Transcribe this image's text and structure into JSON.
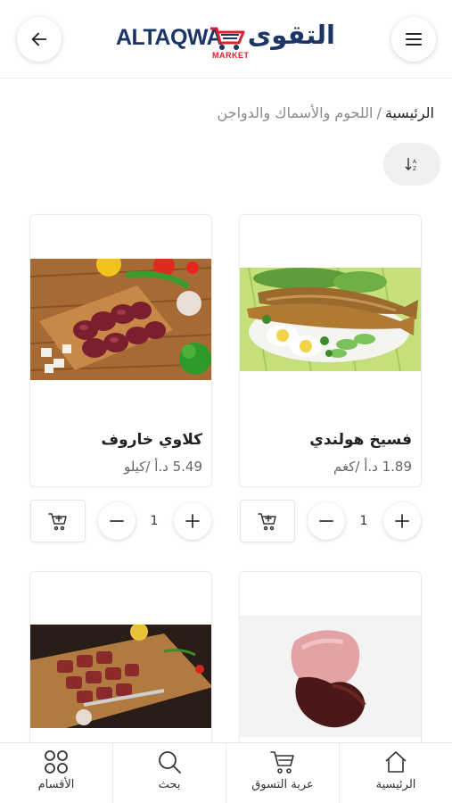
{
  "header": {
    "logo_latin": "ALTAQWA",
    "logo_arabic": "التقوى",
    "logo_market": "MARKET"
  },
  "breadcrumb": {
    "home": "الرئيسية",
    "separator": "/",
    "current": "اللحوم والأسماك والدواجن"
  },
  "products": [
    {
      "name": "فسيخ هولندي",
      "price": "1.89 د.أ /كغم",
      "quantity": "1",
      "image": "smoked-fish"
    },
    {
      "name": "كلاوي خاروف",
      "price": "5.49 د.أ /كيلو",
      "quantity": "1",
      "image": "lamb-kidneys"
    },
    {
      "name": "",
      "price": "",
      "quantity": "",
      "image": "liver"
    },
    {
      "name": "",
      "price": "",
      "quantity": "",
      "image": "meat-cubes"
    }
  ],
  "bottom_nav": [
    {
      "label": "الرئيسية",
      "icon": "home-icon"
    },
    {
      "label": "عربة التسوق",
      "icon": "cart-icon"
    },
    {
      "label": "بحث",
      "icon": "search-icon"
    },
    {
      "label": "الأقسام",
      "icon": "categories-icon"
    }
  ],
  "colors": {
    "brand_navy": "#1c3566",
    "brand_red": "#d8232a"
  }
}
